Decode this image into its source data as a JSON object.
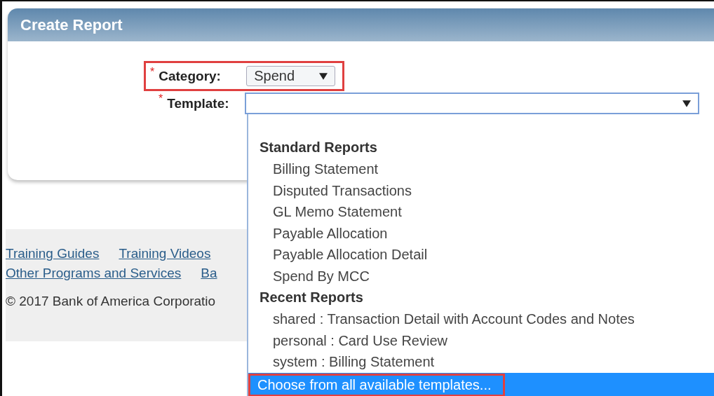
{
  "panel": {
    "title": "Create Report"
  },
  "form": {
    "category": {
      "required_mark": "*",
      "label": "Category:",
      "value": "Spend",
      "annotated": true
    },
    "template": {
      "required_mark": "*",
      "label": "Template:",
      "open": true
    }
  },
  "dropdown": {
    "groups": [
      {
        "heading": "Standard Reports",
        "items": [
          {
            "label": "Billing Statement",
            "selected": false
          },
          {
            "label": "Disputed Transactions",
            "selected": false
          },
          {
            "label": "GL Memo Statement",
            "selected": false
          },
          {
            "label": "Payable Allocation",
            "selected": false
          },
          {
            "label": "Payable Allocation Detail",
            "selected": false
          },
          {
            "label": "Spend By MCC",
            "selected": false
          }
        ]
      },
      {
        "heading": "Recent Reports",
        "items": [
          {
            "label": "shared : Transaction Detail with Account Codes and Notes",
            "selected": false
          },
          {
            "label": "personal : Card Use Review",
            "selected": false
          },
          {
            "label": "system : Billing Statement",
            "selected": false
          }
        ]
      }
    ],
    "footer_option": {
      "label": "Choose from all available templates...",
      "selected": true,
      "annotated": true
    }
  },
  "footer": {
    "link_rows": [
      [
        "Training Guides",
        "Training Videos"
      ],
      [
        "Other Programs and Services",
        "Ba"
      ]
    ],
    "copyright": "© 2017 Bank of America Corporatio"
  }
}
